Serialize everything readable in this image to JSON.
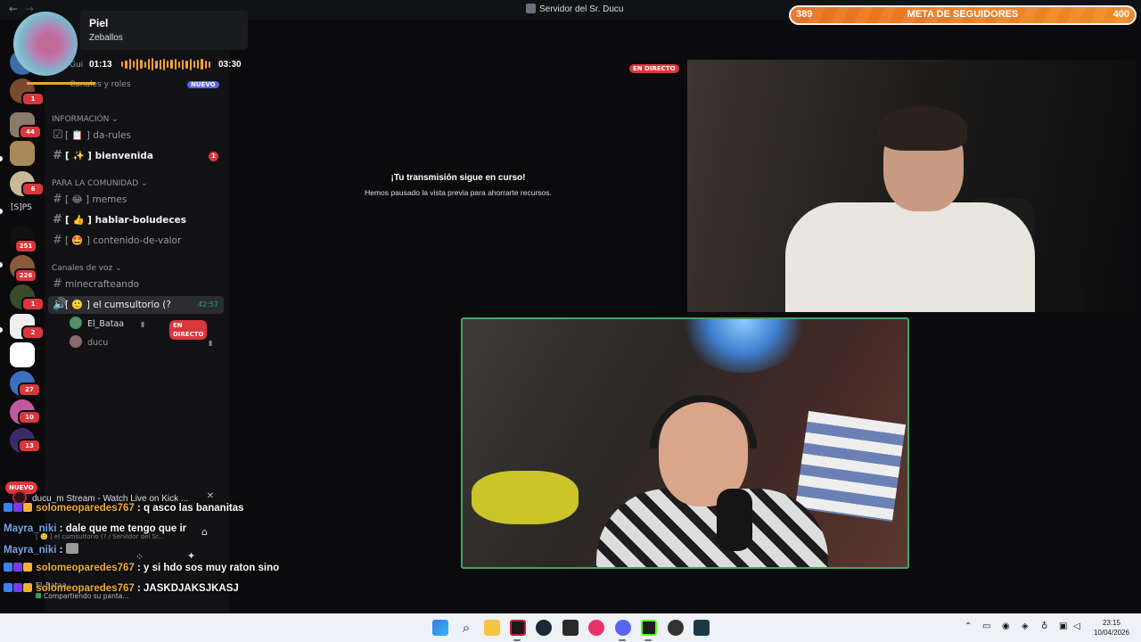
{
  "window": {
    "title": "Servidor del Sr. Ducu",
    "back_icon": "←",
    "forward_icon": "→"
  },
  "music": {
    "song": "Piel",
    "artist": "Zeballos",
    "elapsed": "01:13",
    "duration": "03:30",
    "progress": 0.35,
    "accent": "#f0a03a"
  },
  "rail": {
    "badges": [
      "1",
      "44",
      "6",
      "251",
      "226",
      "1",
      "2",
      "27",
      "10",
      "13"
    ],
    "text_server": "[S]PS",
    "nuevo": "NUEVO"
  },
  "sidebar": {
    "partial_row_1": "Gui",
    "partial_row_2": "Canales y roles",
    "partial_badge": "NUEVO",
    "categories": {
      "info": "INFORMACIÓN",
      "community": "PARA LA COMUNIDAD",
      "voice": "Canales de voz"
    },
    "channels": {
      "rules": "[ 📋 ] da-rules",
      "welcome": "[ ✨ ] bienvenida",
      "welcome_mentions": "1",
      "memes": "[ 😂 ] memes",
      "talk": "[ 👍 ] hablar-boludeces",
      "value": "[ 🤩 ] contenido-de-valor",
      "minecraft": "minecrafteando",
      "cumsultorio": "[ 🙂 ] el cumsultorio (?",
      "cumsultorio_timer": "42:57"
    },
    "voice_users": [
      {
        "name": "El_Bataa",
        "live": "EN DIRECTO"
      },
      {
        "name": "ducu"
      }
    ]
  },
  "stream": {
    "notice_title": "¡Tu transmisión sigue en curso!",
    "notice_subtitle": "Hemos pausado la vista previa para ahorrarte recursos.",
    "live_tag": "EN DIRECTO"
  },
  "goal": {
    "current": "389",
    "label": "META DE SEGUIDORES",
    "target": "400",
    "fraction": 0.9725
  },
  "chat": {
    "kick_title": "ducu_m Stream - Watch Live on Kick ...",
    "mini_caption": "[ 🙂 ] el cumsultorio (? / Servidor del Sr...",
    "share_text": "Compartiendo su panta...",
    "partial_user": "El_Bataa",
    "messages": [
      {
        "user": "solomeoparedes767",
        "sep": " : ",
        "text": "q asco las bananitas",
        "color": "#f2b035"
      },
      {
        "user": "Mayra_niki",
        "sep": " : ",
        "text": "dale que me tengo que ir",
        "color": "#7aa8e8"
      },
      {
        "user": "Mayra_niki",
        "sep": " : ",
        "text": "",
        "color": "#7aa8e8"
      },
      {
        "user": "solomeoparedes767",
        "sep": " : ",
        "text": "y si hdo sos muy raton sino",
        "color": "#f2b035"
      },
      {
        "user": "solomeoparedes767",
        "sep": " : ",
        "text": "JASKDJAKSJKASJ",
        "color": "#f2b035"
      }
    ]
  },
  "taskbar": {
    "time": "23:15",
    "date": "10/04/2026"
  }
}
